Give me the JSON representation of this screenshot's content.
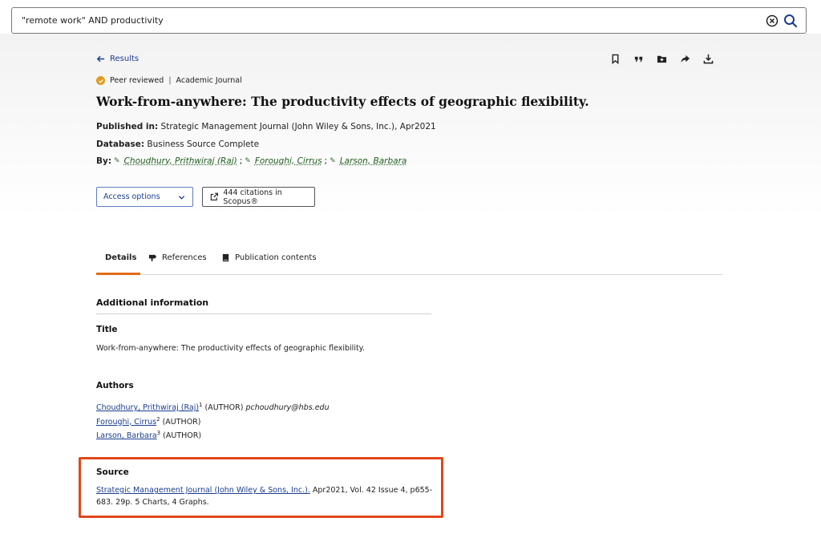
{
  "search": {
    "query": "\"remote work\" AND productivity"
  },
  "nav": {
    "back_label": "Results"
  },
  "toolbar": [
    "bookmark-icon",
    "quote-icon",
    "add-folder-icon",
    "share-icon",
    "download-icon"
  ],
  "record": {
    "peer_reviewed": "Peer reviewed",
    "separator": "|",
    "doc_type": "Academic Journal",
    "title": "Work-from-anywhere: The productivity effects of geographic flexibility.",
    "published_label": "Published in:",
    "published_value": "Strategic Management Journal (John Wiley & Sons, Inc.), Apr2021",
    "database_label": "Database:",
    "database_value": "Business Source Complete",
    "by_label": "By:",
    "authors_short": [
      "Choudhury, Prithwiraj (Raj)",
      "Foroughi, Cirrus",
      "Larson, Barbara"
    ],
    "author_separator": ";"
  },
  "actions": {
    "access_label": "Access options",
    "citations_label": "444 citations in Scopus®"
  },
  "tabs": [
    {
      "label": "Details"
    },
    {
      "label": "References"
    },
    {
      "label": "Publication contents"
    }
  ],
  "details": {
    "heading": "Additional information",
    "title_label": "Title",
    "title_value": "Work-from-anywhere: The productivity effects of geographic flexibility.",
    "authors_label": "Authors",
    "authors": [
      {
        "name": "Choudhury, Prithwiraj (Raj)",
        "sup": "1",
        "role": "(AUTHOR)",
        "email": "pchoudhury@hbs.edu"
      },
      {
        "name": "Foroughi, Cirrus",
        "sup": "2",
        "role": "(AUTHOR)",
        "email": ""
      },
      {
        "name": "Larson, Barbara",
        "sup": "3",
        "role": "(AUTHOR)",
        "email": ""
      }
    ],
    "source_label": "Source",
    "source_link": "Strategic Management Journal (John Wiley & Sons, Inc.).",
    "source_rest": " Apr2021, Vol. 42 Issue 4, p655-683. 29p. 5 Charts, 4 Graphs."
  },
  "colors": {
    "accent": "#e36b16",
    "link": "#1a3d8f",
    "highlight": "#e0471a",
    "badge": "#e39b1b",
    "author_link": "#1f5c1f"
  }
}
